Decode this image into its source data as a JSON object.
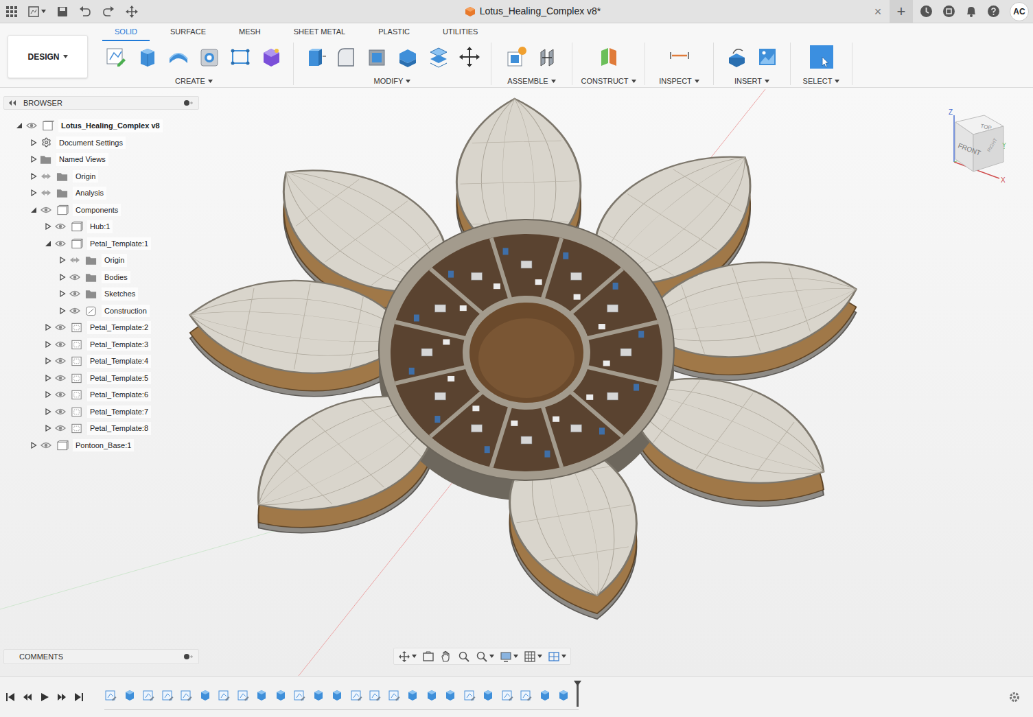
{
  "window": {
    "title": "Lotus_Healing_Complex v8*",
    "close_tab": "×",
    "new_tab": "+",
    "user": "AC"
  },
  "workspace": {
    "label": "DESIGN"
  },
  "tabs": [
    {
      "label": "SOLID",
      "selected": true
    },
    {
      "label": "SURFACE",
      "selected": false
    },
    {
      "label": "MESH",
      "selected": false
    },
    {
      "label": "SHEET METAL",
      "selected": false
    },
    {
      "label": "PLASTIC",
      "selected": false
    },
    {
      "label": "UTILITIES",
      "selected": false
    }
  ],
  "tool_groups": [
    {
      "label": "CREATE"
    },
    {
      "label": "MODIFY"
    },
    {
      "label": "ASSEMBLE"
    },
    {
      "label": "CONSTRUCT"
    },
    {
      "label": "INSPECT"
    },
    {
      "label": "INSERT"
    },
    {
      "label": "SELECT"
    }
  ],
  "browser": {
    "title": "BROWSER",
    "items": [
      {
        "label": "Lotus_Healing_Complex v8",
        "depth": 0,
        "expanded": true,
        "eye": true,
        "kind": "document"
      },
      {
        "label": "Document Settings",
        "depth": 1,
        "expanded": false,
        "eye": false,
        "kind": "settings"
      },
      {
        "label": "Named Views",
        "depth": 1,
        "expanded": false,
        "eye": false,
        "kind": "folder"
      },
      {
        "label": "Origin",
        "depth": 1,
        "expanded": false,
        "eye": true,
        "kind": "origin"
      },
      {
        "label": "Analysis",
        "depth": 1,
        "expanded": false,
        "eye": true,
        "kind": "origin"
      },
      {
        "label": "Components",
        "depth": 1,
        "expanded": true,
        "eye": true,
        "kind": "component"
      },
      {
        "label": "Hub:1",
        "depth": 2,
        "expanded": false,
        "eye": true,
        "kind": "component"
      },
      {
        "label": "Petal_Template:1",
        "depth": 2,
        "expanded": true,
        "eye": true,
        "kind": "component"
      },
      {
        "label": "Origin",
        "depth": 3,
        "expanded": false,
        "eye": true,
        "kind": "origin"
      },
      {
        "label": "Bodies",
        "depth": 3,
        "expanded": false,
        "eye": true,
        "kind": "folder"
      },
      {
        "label": "Sketches",
        "depth": 3,
        "expanded": false,
        "eye": true,
        "kind": "folder"
      },
      {
        "label": "Construction",
        "depth": 3,
        "expanded": false,
        "eye": true,
        "kind": "construction"
      },
      {
        "label": "Petal_Template:2",
        "depth": 2,
        "expanded": false,
        "eye": true,
        "kind": "linked"
      },
      {
        "label": "Petal_Template:3",
        "depth": 2,
        "expanded": false,
        "eye": true,
        "kind": "linked"
      },
      {
        "label": "Petal_Template:4",
        "depth": 2,
        "expanded": false,
        "eye": true,
        "kind": "linked"
      },
      {
        "label": "Petal_Template:5",
        "depth": 2,
        "expanded": false,
        "eye": true,
        "kind": "linked"
      },
      {
        "label": "Petal_Template:6",
        "depth": 2,
        "expanded": false,
        "eye": true,
        "kind": "linked"
      },
      {
        "label": "Petal_Template:7",
        "depth": 2,
        "expanded": false,
        "eye": true,
        "kind": "linked"
      },
      {
        "label": "Petal_Template:8",
        "depth": 2,
        "expanded": false,
        "eye": true,
        "kind": "linked"
      },
      {
        "label": "Pontoon_Base:1",
        "depth": 1,
        "expanded": false,
        "eye": true,
        "kind": "component"
      }
    ]
  },
  "comments": {
    "title": "COMMENTS"
  },
  "viewcube": {
    "faces": [
      "TOP",
      "FRONT",
      "RIGHT"
    ],
    "axes": [
      "Z",
      "X",
      "Y"
    ]
  },
  "timeline": {
    "level": 1,
    "features": [
      {
        "kind": "sketch"
      },
      {
        "kind": "solid"
      },
      {
        "kind": "sketch"
      },
      {
        "kind": "sketch"
      },
      {
        "kind": "sketch"
      },
      {
        "kind": "solid"
      },
      {
        "kind": "sketch"
      },
      {
        "kind": "sketch"
      },
      {
        "kind": "solid"
      },
      {
        "kind": "solid"
      },
      {
        "kind": "sketch"
      },
      {
        "kind": "solid"
      },
      {
        "kind": "solid"
      },
      {
        "kind": "sketch"
      },
      {
        "kind": "sketch"
      },
      {
        "kind": "sketch"
      },
      {
        "kind": "solid"
      },
      {
        "kind": "solid"
      },
      {
        "kind": "solid"
      },
      {
        "kind": "sketch"
      },
      {
        "kind": "solid"
      },
      {
        "kind": "sketch"
      },
      {
        "kind": "sketch"
      },
      {
        "kind": "solid"
      },
      {
        "kind": "solid"
      }
    ]
  }
}
